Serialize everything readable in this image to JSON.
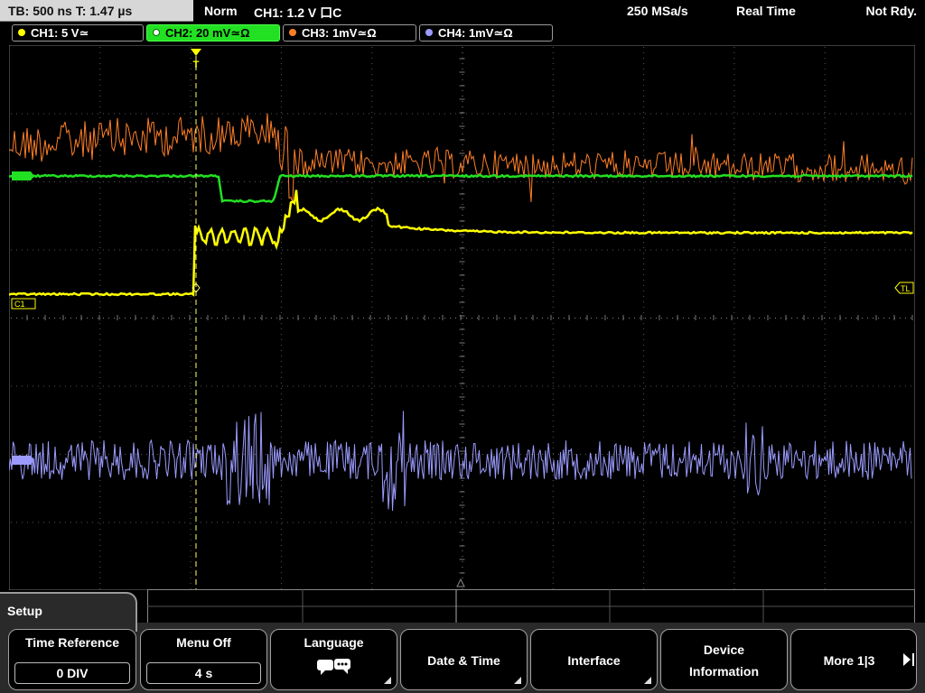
{
  "status_bar": {
    "timebase": "TB: 500 ns   T: 1.47 µs",
    "mode": "Norm",
    "trigger": "CH1: 1.2 V ⼝C",
    "sample_rate": "250 MSa/s",
    "acquisition": "Real Time",
    "ready": "Not Rdy."
  },
  "channels": [
    {
      "label": "CH1: 5 V≃",
      "color": "#ffff00",
      "active": false
    },
    {
      "label": "CH2: 20 mV≃Ω",
      "color": "#22e022",
      "active": true
    },
    {
      "label": "CH3: 1mV≃Ω",
      "color": "#ff7f27",
      "active": false
    },
    {
      "label": "CH4: 1mV≃Ω",
      "color": "#9b9bff",
      "active": false
    }
  ],
  "markers": {
    "ch1_ref": "C1",
    "trigger_level": "TL",
    "trigger_pos": "T"
  },
  "colors": {
    "ch1": "#ffff00",
    "ch2": "#22e022",
    "ch3": "#ff7f27",
    "ch4": "#9b9bff",
    "grid": "#4a4a4a",
    "trigger_marker": "#ffff00"
  },
  "menu": {
    "title": "Setup",
    "softkeys": [
      {
        "title": "Time Reference",
        "value": "0 DIV"
      },
      {
        "title": "Menu Off",
        "value": "4 s"
      },
      {
        "title": "Language",
        "icon": "speech-bubble-icon"
      },
      {
        "title": "Date & Time"
      },
      {
        "title": "Interface"
      },
      {
        "title_line1": "Device",
        "title_line2": "Information"
      },
      {
        "title": "More 1|3"
      }
    ]
  }
}
